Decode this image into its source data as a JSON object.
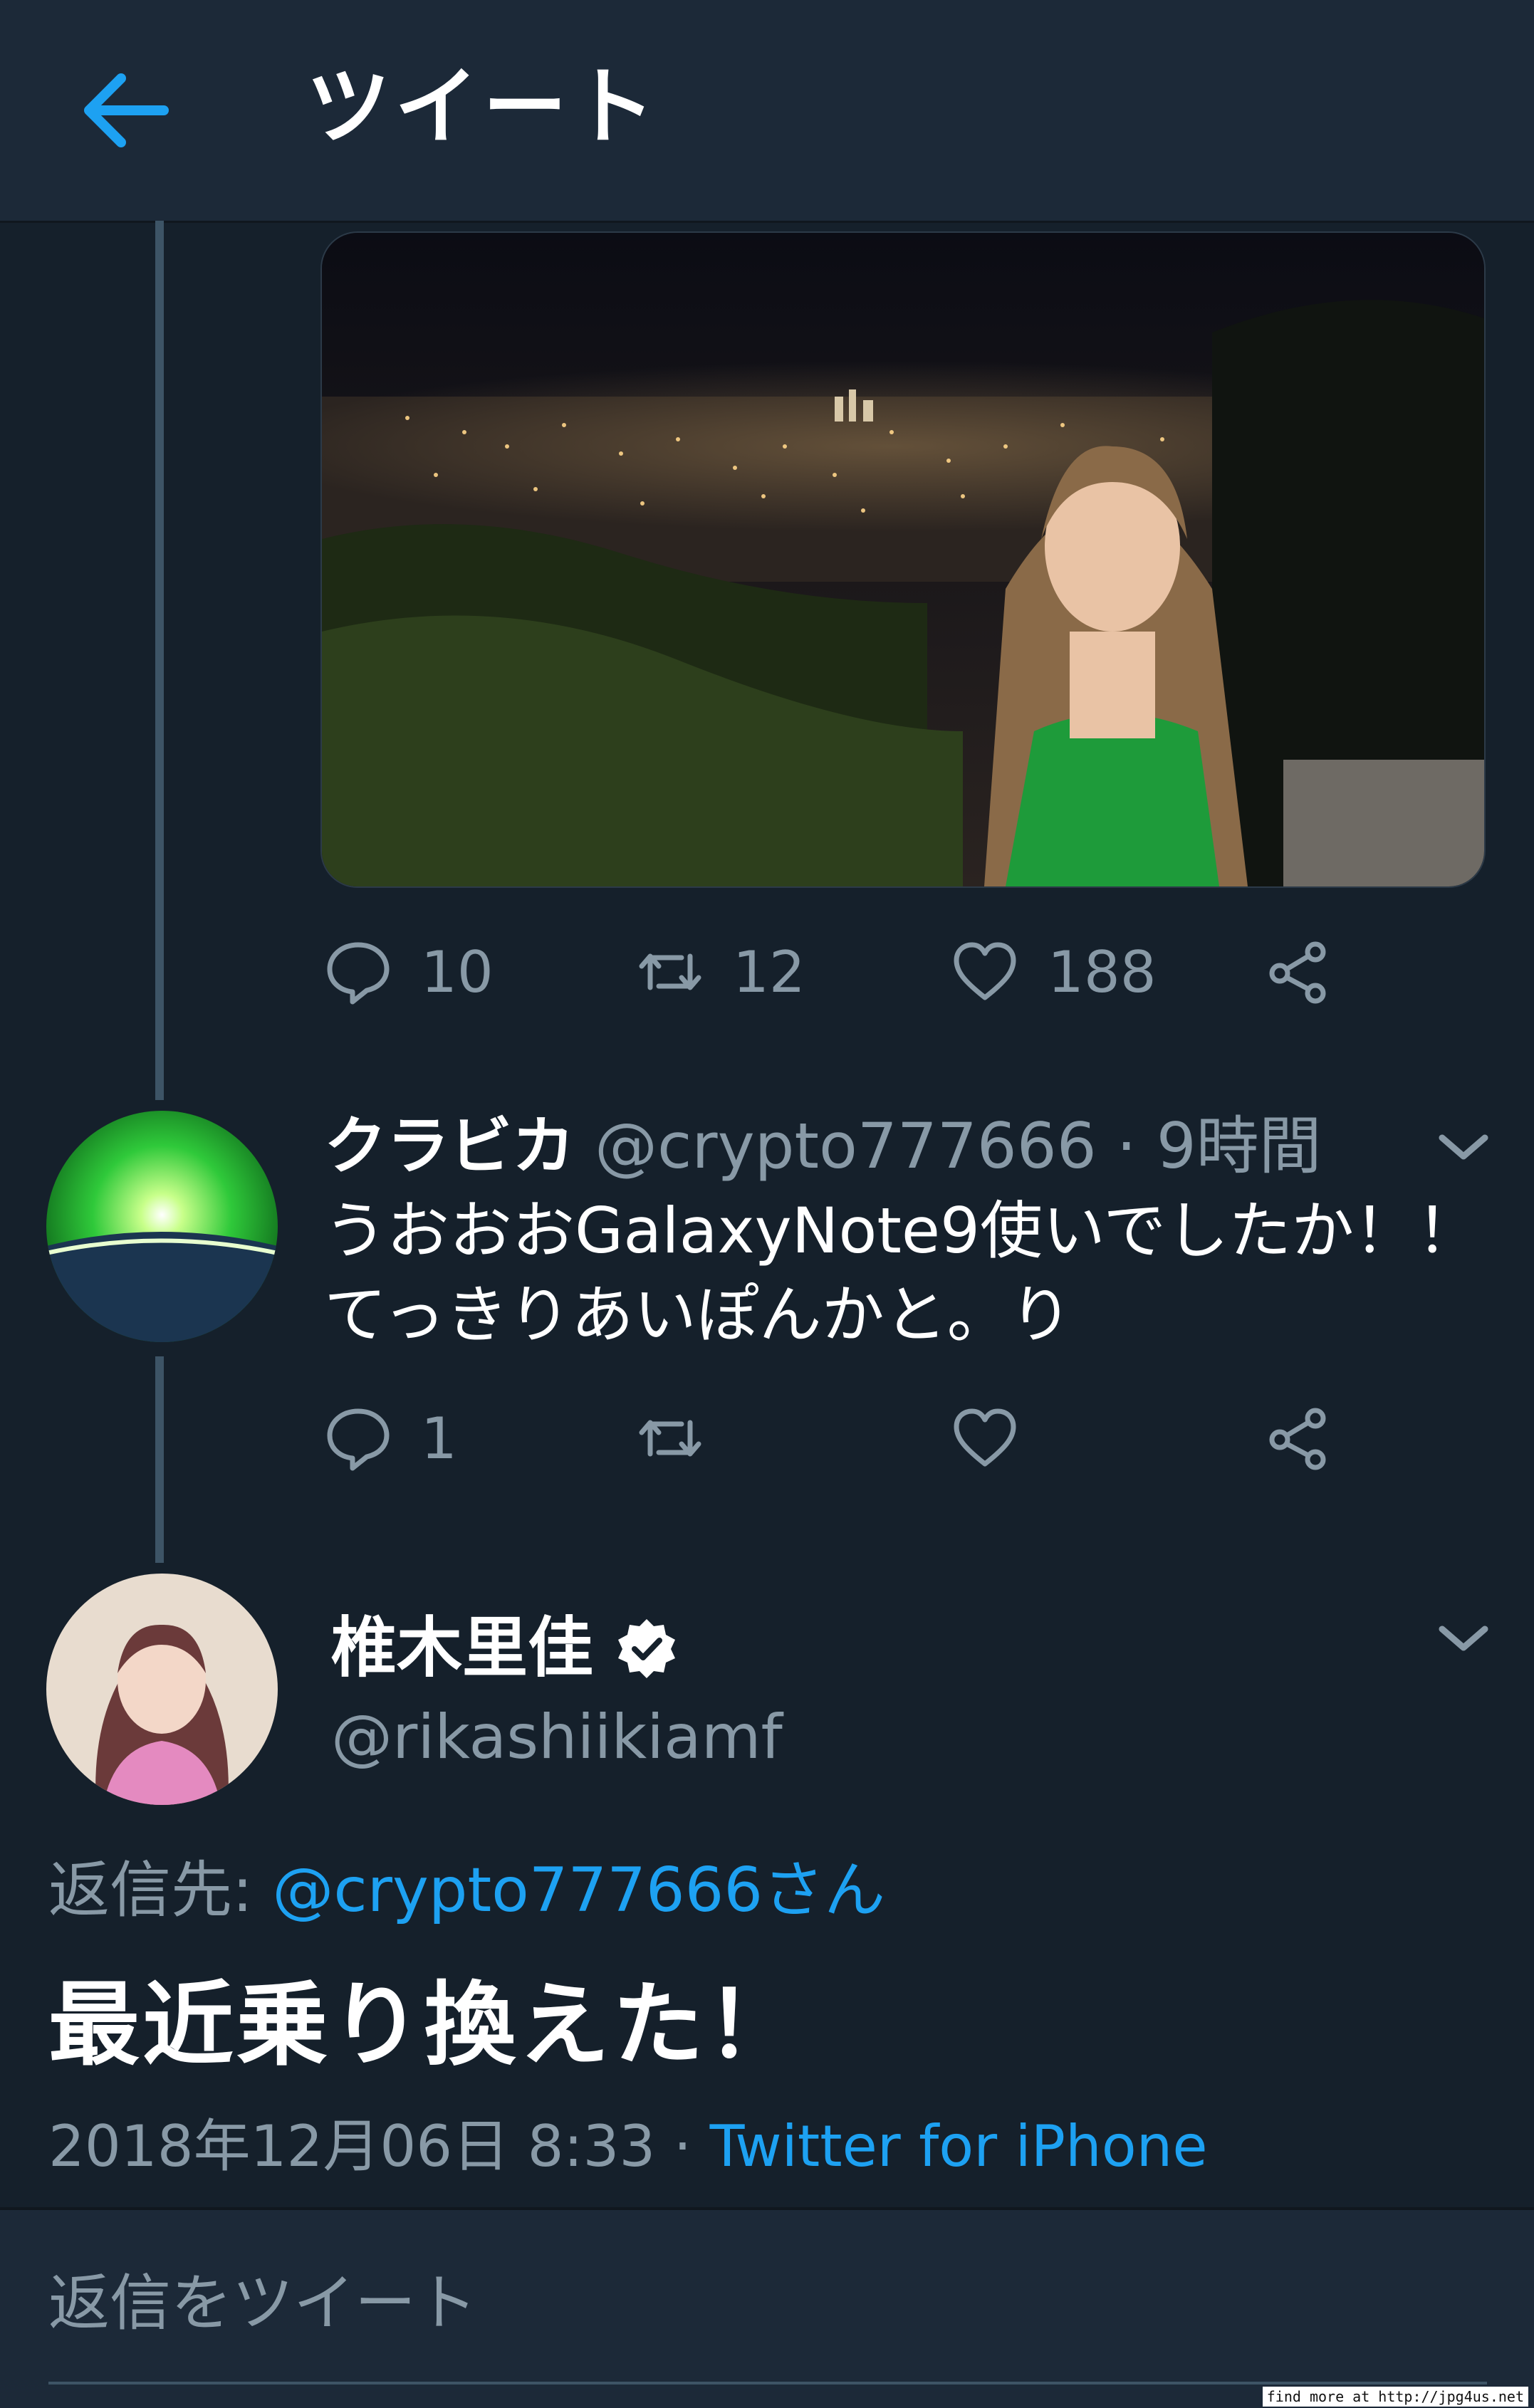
{
  "header": {
    "title": "ツイート",
    "back_icon": "arrow-left-icon"
  },
  "colors": {
    "accent": "#1da1f2",
    "background": "#15202b",
    "header": "#1c2938",
    "muted": "#8899a6"
  },
  "prev_tweet": {
    "replies": "10",
    "retweets": "12",
    "likes": "188"
  },
  "reply_tweet": {
    "name": "クラビカ",
    "handle_time": "@crypto777666 · 9時間",
    "text_line1": "うおおおGalaxyNote9使いでしたか！！",
    "text_line2": "てっきりあいぽんかと。り",
    "replies": "1"
  },
  "main_tweet": {
    "name": "椎木里佳",
    "handle": "@rikashiikiamf",
    "reply_label": "返信先: ",
    "reply_target": "@crypto777666さん",
    "text": "最近乗り換えた！",
    "timestamp": "2018年12月06日 8:33 · ",
    "source": "Twitter for iPhone"
  },
  "reply_box": {
    "placeholder": "返信をツイート"
  },
  "footer_note": "find more at http://jpg4us.net"
}
